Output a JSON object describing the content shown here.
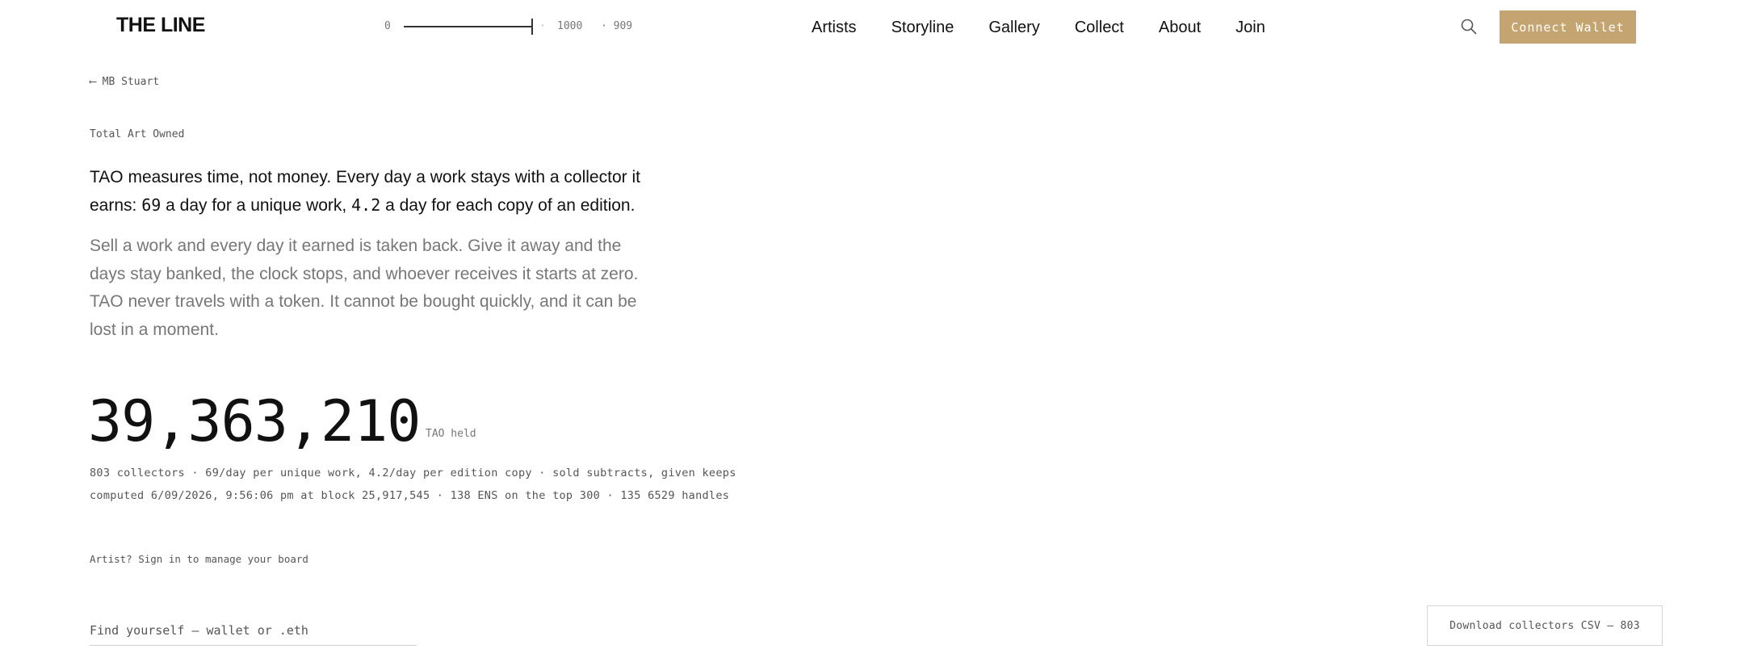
{
  "header": {
    "logo": "THE LINE",
    "slider": {
      "min": "0",
      "separator": "·",
      "max": "1000",
      "count": "· 909",
      "value": 909,
      "range": [
        0,
        1000
      ]
    },
    "nav": [
      {
        "label": "Artists"
      },
      {
        "label": "Storyline"
      },
      {
        "label": "Gallery"
      },
      {
        "label": "Collect"
      },
      {
        "label": "About"
      },
      {
        "label": "Join"
      }
    ],
    "search_icon": "search-icon",
    "wallet_label": "Connect Wallet",
    "accent_color": "#c4a470"
  },
  "back_link": "⟵ MB Stuart",
  "section_label": "Total Art Owned",
  "lead": {
    "part1": "TAO measures time, not money. Every day a work stays with a collector it earns: ",
    "rate_unique": "69",
    "part2": " a day for a unique work, ",
    "rate_edition": "4.2",
    "part3": " a day for each copy of an edition."
  },
  "body_text": "Sell a work and every day it earned is taken back. Give it away and the days stay banked, the clock stops, and whoever receives it starts at zero. TAO never travels with a token. It cannot be bought quickly, and it can be lost in a moment.",
  "total": {
    "value": "39,363,210",
    "unit": "TAO held"
  },
  "stats_line1": "803 collectors · 69/day per unique work, 4.2/day per edition copy · sold subtracts, given keeps",
  "stats_line2": "computed 6/09/2026, 9:56:06 pm at block 25,917,545 · 138 ENS on the top 300 · 135 6529 handles",
  "signin_link": "Artist? Sign in to manage your board",
  "search_field": {
    "placeholder": "Find yourself — wallet or .eth",
    "value": ""
  },
  "csv_button": "Download collectors CSV — 803"
}
